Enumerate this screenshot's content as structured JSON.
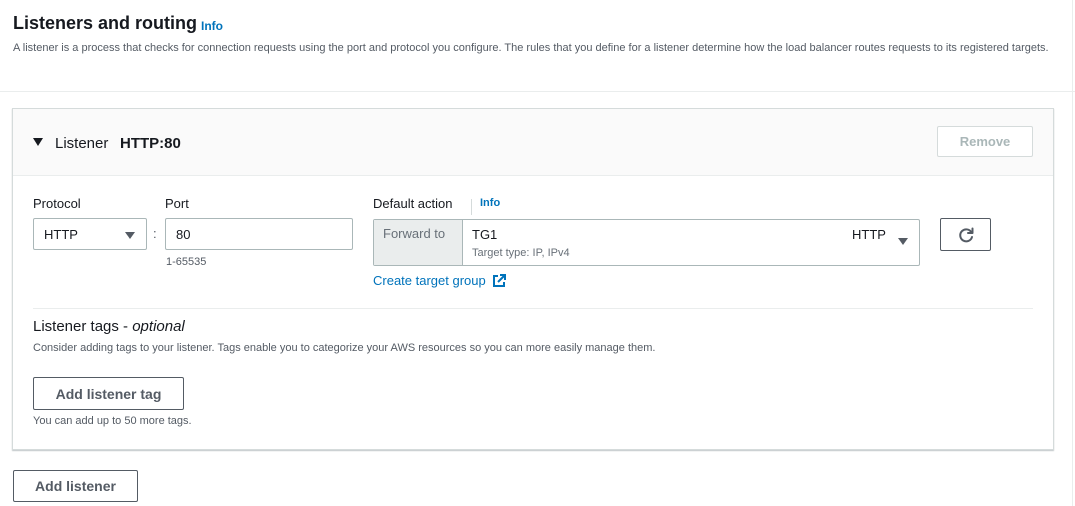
{
  "section": {
    "title": "Listeners and routing",
    "info_label": "Info",
    "description": "A listener is a process that checks for connection requests using the port and protocol you configure. The rules that you define for a listener determine how the load balancer routes requests to its registered targets."
  },
  "listener": {
    "label": "Listener",
    "value": "HTTP:80",
    "remove_label": "Remove",
    "protocol": {
      "label": "Protocol",
      "value": "HTTP"
    },
    "separator": ":",
    "port": {
      "label": "Port",
      "value": "80",
      "hint": "1-65535"
    },
    "default_action": {
      "label": "Default action",
      "info_label": "Info",
      "forward_label": "Forward to",
      "target_group_name": "TG1",
      "target_group_type": "Target type: IP, IPv4",
      "target_group_protocol": "HTTP",
      "create_link": "Create target group"
    },
    "tags": {
      "title": "Listener tags - ",
      "title_optional": "optional",
      "description": "Consider adding tags to your listener. Tags enable you to categorize your AWS resources so you can more easily manage them.",
      "add_button": "Add listener tag",
      "hint": "You can add up to 50 more tags."
    }
  },
  "add_listener_label": "Add listener",
  "icons": {
    "expand": "caret-down-icon",
    "dropdown": "triangle-down-icon",
    "refresh": "refresh-icon",
    "external": "external-link-icon"
  },
  "colors": {
    "link": "#0073bb",
    "text": "#16191f",
    "muted": "#545b64",
    "border": "#aab7b8"
  }
}
